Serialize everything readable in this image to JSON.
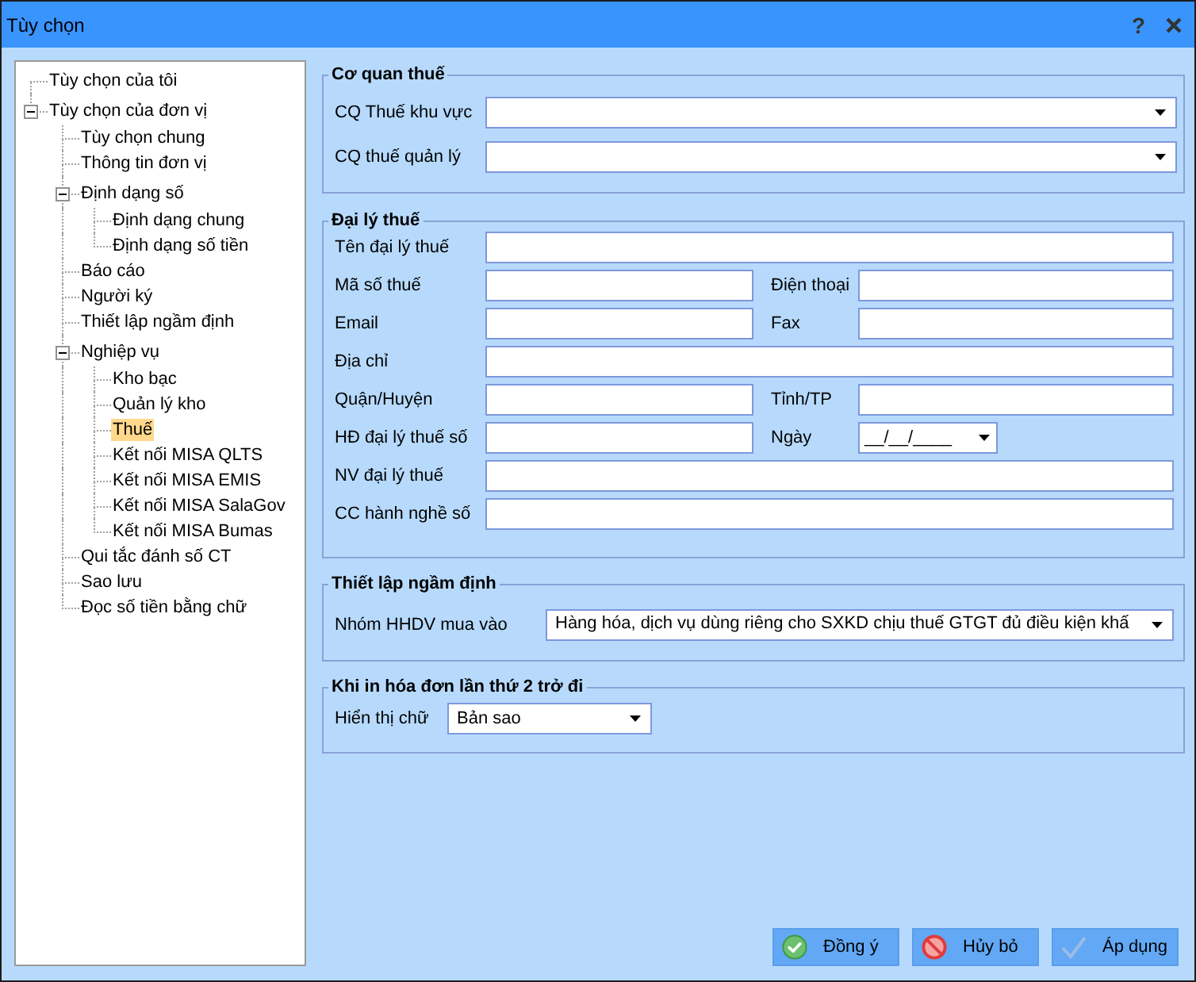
{
  "window": {
    "title": "Tùy chọn",
    "help": "?"
  },
  "tree": {
    "items": [
      {
        "label": "Tùy chọn của tôi",
        "selected": false
      },
      {
        "label": "Tùy chọn của đơn vị",
        "selected": false,
        "expanded": true,
        "children": [
          {
            "label": "Tùy chọn chung",
            "selected": false
          },
          {
            "label": "Thông tin đơn vị",
            "selected": false
          },
          {
            "label": "Định dạng số",
            "selected": false,
            "expanded": true,
            "children": [
              {
                "label": "Định dạng chung",
                "selected": false
              },
              {
                "label": "Định dạng số tiền",
                "selected": false
              }
            ]
          },
          {
            "label": "Báo cáo",
            "selected": false
          },
          {
            "label": "Người ký",
            "selected": false
          },
          {
            "label": "Thiết lập ngầm định",
            "selected": false
          },
          {
            "label": "Nghiệp vụ",
            "selected": false,
            "expanded": true,
            "children": [
              {
                "label": "Kho bạc",
                "selected": false
              },
              {
                "label": "Quản lý kho",
                "selected": false
              },
              {
                "label": "Thuế",
                "selected": true
              },
              {
                "label": "Kết nối MISA QLTS",
                "selected": false
              },
              {
                "label": "Kết nối MISA EMIS",
                "selected": false
              },
              {
                "label": "Kết nối MISA SalaGov",
                "selected": false
              },
              {
                "label": "Kết nối MISA Bumas",
                "selected": false
              }
            ]
          },
          {
            "label": "Qui tắc đánh số CT",
            "selected": false
          },
          {
            "label": "Sao lưu",
            "selected": false
          },
          {
            "label": "Đọc số tiền bằng chữ",
            "selected": false
          }
        ]
      }
    ]
  },
  "tax_office": {
    "title": "Cơ quan thuế",
    "fields": [
      {
        "label": "CQ Thuế khu vực",
        "kind": "dropdown"
      },
      {
        "label": "CQ thuế quản lý",
        "kind": "dropdown"
      }
    ]
  },
  "tax_agent": {
    "title": "Đại lý thuế",
    "rows": [
      [
        {
          "label": "Tên đại lý thuế",
          "kind": "text"
        }
      ],
      [
        {
          "label": "Mã số thuế",
          "kind": "text"
        },
        {
          "label": "Điện thoại",
          "kind": "text"
        }
      ],
      [
        {
          "label": "Email",
          "kind": "text"
        },
        {
          "label": "Fax",
          "kind": "text"
        }
      ],
      [
        {
          "label": "Địa chỉ",
          "kind": "text"
        }
      ],
      [
        {
          "label": "Quận/Huyện",
          "kind": "text"
        },
        {
          "label": "Tỉnh/TP",
          "kind": "text"
        }
      ],
      [
        {
          "label": "HĐ đại lý thuế số",
          "kind": "text"
        },
        {
          "label": "Ngày",
          "kind": "date",
          "value": "__/__/____"
        }
      ],
      [
        {
          "label": "NV đại lý thuế",
          "kind": "text"
        }
      ],
      [
        {
          "label": "CC hành nghề số",
          "kind": "text"
        }
      ]
    ]
  },
  "default_settings": {
    "title": "Thiết lập ngầm định",
    "fields": [
      {
        "label": "Nhóm HHDV mua vào",
        "kind": "dropdown",
        "value": "Hàng hóa, dịch vụ dùng riêng cho SXKD chịu thuế GTGT đủ điều kiện khấ"
      }
    ]
  },
  "reprint": {
    "title": "Khi in hóa đơn lần thứ 2 trở đi",
    "fields": [
      {
        "label": "Hiển thị chữ",
        "kind": "dropdown",
        "value": "Bản sao"
      }
    ]
  },
  "buttons": [
    {
      "label": "Đồng ý",
      "kind": "ok"
    },
    {
      "label": "Hủy bỏ",
      "kind": "cancel"
    },
    {
      "label": "Áp dụng",
      "kind": "apply"
    }
  ]
}
